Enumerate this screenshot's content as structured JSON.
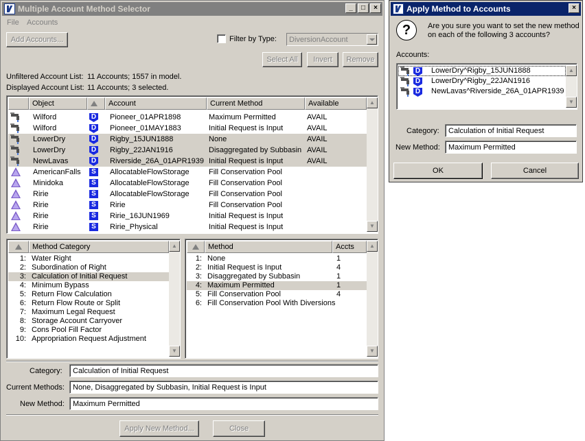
{
  "main_window": {
    "title": "Multiple Account Method Selector",
    "menu": [
      "File",
      "Accounts"
    ],
    "add_accounts": "Add Accounts...",
    "filter_label": "Filter by Type:",
    "filter_checked": false,
    "filter_value": "DiversionAccount",
    "select_all": "Select All",
    "invert": "Invert",
    "remove": "Remove",
    "unfiltered_label": "Unfiltered Account List:",
    "unfiltered_value": "11 Accounts;  1557 in model.",
    "displayed_label": "Displayed Account List:",
    "displayed_value": "11 Accounts;  3 selected.",
    "account_table": {
      "headers": [
        "Object",
        "",
        "Account",
        "Current Method",
        "Available"
      ],
      "rows": [
        {
          "object_icon": "diversion-faucet-icon",
          "object": "Wilford",
          "type": "D",
          "account": "Pioneer_01APR1898",
          "method": "Maximum Permitted",
          "available": "AVAIL",
          "selected": false
        },
        {
          "object_icon": "diversion-faucet-icon",
          "object": "Wilford",
          "type": "D",
          "account": "Pioneer_01MAY1883",
          "method": "Initial Request is Input",
          "available": "AVAIL",
          "selected": false
        },
        {
          "object_icon": "diversion-faucet-icon",
          "object": "LowerDry",
          "type": "D",
          "account": "Rigby_15JUN1888",
          "method": "None",
          "available": "AVAIL",
          "selected": true
        },
        {
          "object_icon": "diversion-faucet-icon",
          "object": "LowerDry",
          "type": "D",
          "account": "Rigby_22JAN1916",
          "method": "Disaggregated by Subbasin",
          "available": "AVAIL",
          "selected": true
        },
        {
          "object_icon": "diversion-faucet-icon",
          "object": "NewLavas",
          "type": "D",
          "account": "Riverside_26A_01APR1939",
          "method": "Initial Request is Input",
          "available": "AVAIL",
          "selected": true
        },
        {
          "object_icon": "reservoir-triangle-icon",
          "object": "AmericanFalls",
          "type": "S",
          "account": "AllocatableFlowStorage",
          "method": "Fill Conservation Pool",
          "available": "",
          "selected": false
        },
        {
          "object_icon": "reservoir-triangle-icon",
          "object": "Minidoka",
          "type": "S",
          "account": "AllocatableFlowStorage",
          "method": "Fill Conservation Pool",
          "available": "",
          "selected": false
        },
        {
          "object_icon": "reservoir-triangle-icon",
          "object": "Ririe",
          "type": "S",
          "account": "AllocatableFlowStorage",
          "method": "Fill Conservation Pool",
          "available": "",
          "selected": false
        },
        {
          "object_icon": "reservoir-triangle-icon",
          "object": "Ririe",
          "type": "S",
          "account": "Ririe",
          "method": "Fill Conservation Pool",
          "available": "",
          "selected": false
        },
        {
          "object_icon": "reservoir-triangle-icon",
          "object": "Ririe",
          "type": "S",
          "account": "Ririe_16JUN1969",
          "method": "Initial Request is Input",
          "available": "",
          "selected": false
        },
        {
          "object_icon": "reservoir-triangle-icon",
          "object": "Ririe",
          "type": "S",
          "account": "Ririe_Physical",
          "method": "Initial Request is Input",
          "available": "",
          "selected": false
        }
      ]
    },
    "category_table": {
      "header": "Method Category",
      "rows": [
        {
          "num": "1:",
          "label": "Water Right",
          "selected": false
        },
        {
          "num": "2:",
          "label": "Subordination of Right",
          "selected": false
        },
        {
          "num": "3:",
          "label": "Calculation of Initial Request",
          "selected": true
        },
        {
          "num": "4:",
          "label": "Minimum Bypass",
          "selected": false
        },
        {
          "num": "5:",
          "label": "Return Flow Calculation",
          "selected": false
        },
        {
          "num": "6:",
          "label": "Return Flow Route or Split",
          "selected": false
        },
        {
          "num": "7:",
          "label": "Maximum Legal Request",
          "selected": false
        },
        {
          "num": "8:",
          "label": "Storage Account Carryover",
          "selected": false
        },
        {
          "num": "9:",
          "label": "Cons Pool Fill Factor",
          "selected": false
        },
        {
          "num": "10:",
          "label": "Appropriation Request Adjustment",
          "selected": false
        }
      ]
    },
    "method_table": {
      "headers": [
        "Method",
        "Accts"
      ],
      "rows": [
        {
          "num": "1:",
          "label": "None",
          "accts": "1",
          "selected": false
        },
        {
          "num": "2:",
          "label": "Initial Request is Input",
          "accts": "4",
          "selected": false
        },
        {
          "num": "3:",
          "label": "Disaggregated by Subbasin",
          "accts": "1",
          "selected": false
        },
        {
          "num": "4:",
          "label": "Maximum Permitted",
          "accts": "1",
          "selected": true
        },
        {
          "num": "5:",
          "label": "Fill Conservation Pool",
          "accts": "4",
          "selected": false
        },
        {
          "num": "6:",
          "label": "Fill Conservation Pool With Diversions",
          "accts": "",
          "selected": false
        }
      ]
    },
    "category_label": "Category:",
    "category_value": "Calculation of Initial Request",
    "current_methods_label": "Current Methods:",
    "current_methods_value": "None, Disaggregated by Subbasin, Initial Request is Input",
    "new_method_label": "New Method:",
    "new_method_value": "Maximum Permitted",
    "apply_button": "Apply New Method...",
    "close_button": "Close"
  },
  "dialog": {
    "title": "Apply Method to Accounts",
    "message_line1": "Are you sure you want to set the new method",
    "message_line2": "on each of the following 3 accounts?",
    "accounts_label": "Accounts:",
    "accounts": [
      {
        "name": "LowerDry^Rigby_15JUN1888",
        "type": "D"
      },
      {
        "name": "LowerDry^Rigby_22JAN1916",
        "type": "D"
      },
      {
        "name": "NewLavas^Riverside_26A_01APR1939",
        "type": "D"
      }
    ],
    "category_label": "Category:",
    "category_value": "Calculation of Initial Request",
    "new_method_label": "New Method:",
    "new_method_value": "Maximum Permitted",
    "ok": "OK",
    "cancel": "Cancel"
  }
}
